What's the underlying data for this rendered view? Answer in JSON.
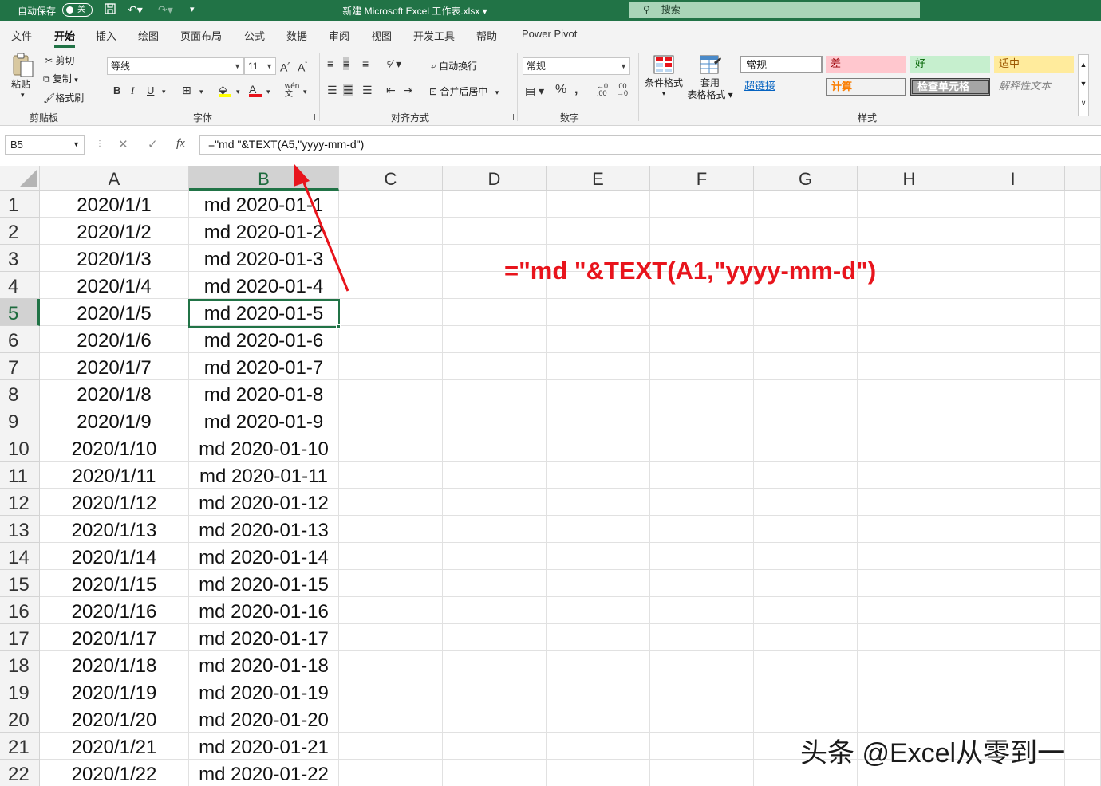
{
  "titlebar": {
    "autosave_label": "自动保存",
    "autosave_state": "关",
    "doc_title": "新建 Microsoft Excel 工作表.xlsx",
    "search_label": "搜索"
  },
  "tabs": [
    "文件",
    "开始",
    "插入",
    "绘图",
    "页面布局",
    "公式",
    "数据",
    "审阅",
    "视图",
    "开发工具",
    "帮助",
    "Power Pivot"
  ],
  "active_tab": "开始",
  "ribbon": {
    "clipboard": {
      "paste": "粘贴",
      "cut": "剪切",
      "copy": "复制",
      "format_painter": "格式刷",
      "label": "剪贴板"
    },
    "font": {
      "name": "等线",
      "size": "11",
      "label": "字体"
    },
    "alignment": {
      "wrap_text": "自动换行",
      "merge_center": "合并后居中",
      "label": "对齐方式"
    },
    "number": {
      "format": "常规",
      "label": "数字"
    },
    "styles": {
      "conditional_format": "条件格式",
      "table_format_1": "套用",
      "table_format_2": "表格格式",
      "cells": {
        "normal": "常规",
        "bad": "差",
        "good": "好",
        "neutral": "适中",
        "hyperlink": "超链接",
        "calculation": "计算",
        "check_cell": "检查单元格",
        "explanatory": "解释性文本"
      },
      "label": "样式"
    }
  },
  "formula_bar": {
    "name_box": "B5",
    "formula": "=\"md \"&TEXT(A5,\"yyyy-mm-d\")"
  },
  "sheet": {
    "columns": [
      "A",
      "B",
      "C",
      "D",
      "E",
      "F",
      "G",
      "H",
      "I"
    ],
    "selected_column": "B",
    "selected_row": 5,
    "rows": [
      {
        "n": "1",
        "a": "2020/1/1",
        "b": "md 2020-01-1"
      },
      {
        "n": "2",
        "a": "2020/1/2",
        "b": "md 2020-01-2"
      },
      {
        "n": "3",
        "a": "2020/1/3",
        "b": "md 2020-01-3"
      },
      {
        "n": "4",
        "a": "2020/1/4",
        "b": "md 2020-01-4"
      },
      {
        "n": "5",
        "a": "2020/1/5",
        "b": "md 2020-01-5"
      },
      {
        "n": "6",
        "a": "2020/1/6",
        "b": "md 2020-01-6"
      },
      {
        "n": "7",
        "a": "2020/1/7",
        "b": "md 2020-01-7"
      },
      {
        "n": "8",
        "a": "2020/1/8",
        "b": "md 2020-01-8"
      },
      {
        "n": "9",
        "a": "2020/1/9",
        "b": "md 2020-01-9"
      },
      {
        "n": "10",
        "a": "2020/1/10",
        "b": "md 2020-01-10"
      },
      {
        "n": "11",
        "a": "2020/1/11",
        "b": "md 2020-01-11"
      },
      {
        "n": "12",
        "a": "2020/1/12",
        "b": "md 2020-01-12"
      },
      {
        "n": "13",
        "a": "2020/1/13",
        "b": "md 2020-01-13"
      },
      {
        "n": "14",
        "a": "2020/1/14",
        "b": "md 2020-01-14"
      },
      {
        "n": "15",
        "a": "2020/1/15",
        "b": "md 2020-01-15"
      },
      {
        "n": "16",
        "a": "2020/1/16",
        "b": "md 2020-01-16"
      },
      {
        "n": "17",
        "a": "2020/1/17",
        "b": "md 2020-01-17"
      },
      {
        "n": "18",
        "a": "2020/1/18",
        "b": "md 2020-01-18"
      },
      {
        "n": "19",
        "a": "2020/1/19",
        "b": "md 2020-01-19"
      },
      {
        "n": "20",
        "a": "2020/1/20",
        "b": "md 2020-01-20"
      },
      {
        "n": "21",
        "a": "2020/1/21",
        "b": "md 2020-01-21"
      },
      {
        "n": "22",
        "a": "2020/1/22",
        "b": "md 2020-01-22"
      }
    ]
  },
  "annotation": "=\"md \"&TEXT(A1,\"yyyy-mm-d\")",
  "watermark": "头条 @Excel从零到一",
  "colors": {
    "brand": "#217346",
    "annotation": "#e8141c"
  },
  "icons": [
    "save-icon",
    "undo-icon",
    "redo-icon",
    "customize-icon",
    "search-icon",
    "scissors-icon",
    "copy-icon",
    "brush-icon",
    "fx-icon"
  ]
}
